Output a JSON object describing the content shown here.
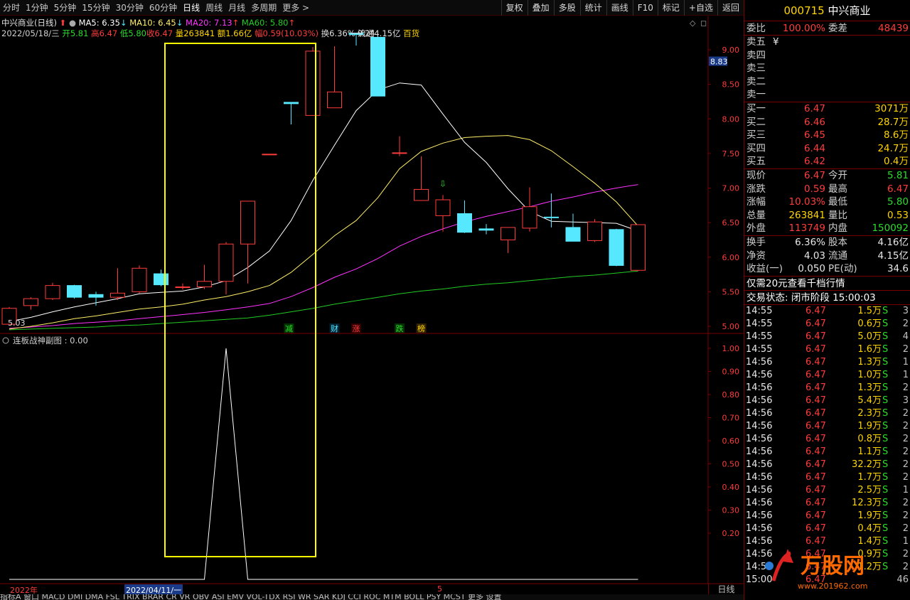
{
  "toolbar": {
    "periods": [
      "分时",
      "1分钟",
      "5分钟",
      "15分钟",
      "30分钟",
      "60分钟",
      "日线",
      "周线",
      "月线",
      "多周期",
      "更多 >"
    ],
    "active_period": "日线",
    "buttons": [
      "复权",
      "叠加",
      "多股",
      "统计",
      "画线",
      "F10",
      "标记",
      "+自选",
      "返回"
    ]
  },
  "chart_header": {
    "title": "中兴商业(日线)",
    "ma5": "MA5: 6.35",
    "ma10": "MA10: 6.45",
    "ma20": "MA20: 7.13",
    "ma60": "MA60: 5.80",
    "date": "2022/05/18/三",
    "open": "开5.81",
    "high": "高6.47",
    "low": "低5.80",
    "close": "收6.47",
    "volume": "量263841",
    "amount": "额1.66亿",
    "change": "幅0.59(10.03%)",
    "turnover": "换6.36%",
    "float_cap": "流通4.15亿",
    "sector": "百货",
    "current_price_tag": "8.83",
    "high_label": "9.24",
    "low_label": "5.03",
    "price_ticks": [
      "9.00",
      "8.50",
      "8.00",
      "7.50",
      "7.00",
      "6.50",
      "6.00",
      "5.50",
      "5.00"
    ],
    "event_markers": [
      "减",
      "财",
      "涨",
      "跌",
      "榜"
    ]
  },
  "indicator": {
    "title": "连板战神副图 : 0.00",
    "ticks": [
      "1.00",
      "0.90",
      "0.80",
      "0.70",
      "0.60",
      "0.50",
      "0.40",
      "0.30",
      "0.20"
    ]
  },
  "time_axis": {
    "year": "2022年",
    "cursor_date": "2022/04/11/一",
    "month": "5",
    "period_label": "日线"
  },
  "bottom_tabs": "指标A 窗口  MACD  DMI  DMA  FSL  TRIX  BRAR  CR  VR  OBV  ASI  EMV  VOL-TDX  RSI  WR  SAR  KDJ  CCI  ROC  MTM  BOLL  PSY  MCST  更多  设置",
  "quote": {
    "code": "000715",
    "name": "中兴商业",
    "weibi_label": "委比",
    "weibi": "100.00%",
    "weicha_label": "委差",
    "weicha": "48439",
    "sell": [
      {
        "label": "卖五",
        "price": "¥",
        "vol": ""
      },
      {
        "label": "卖四",
        "price": "",
        "vol": ""
      },
      {
        "label": "卖三",
        "price": "",
        "vol": ""
      },
      {
        "label": "卖二",
        "price": "",
        "vol": ""
      },
      {
        "label": "卖一",
        "price": "",
        "vol": ""
      }
    ],
    "buy": [
      {
        "label": "买一",
        "price": "6.47",
        "vol": "3071万"
      },
      {
        "label": "买二",
        "price": "6.46",
        "vol": "28.7万"
      },
      {
        "label": "买三",
        "price": "6.45",
        "vol": "8.6万"
      },
      {
        "label": "买四",
        "price": "6.44",
        "vol": "24.7万"
      },
      {
        "label": "买五",
        "price": "6.42",
        "vol": "0.4万"
      }
    ],
    "stats": [
      {
        "l1": "现价",
        "v1": "6.47",
        "c1": "red",
        "l2": "今开",
        "v2": "5.81",
        "c2": "green"
      },
      {
        "l1": "涨跌",
        "v1": "0.59",
        "c1": "red",
        "l2": "最高",
        "v2": "6.47",
        "c2": "red"
      },
      {
        "l1": "涨幅",
        "v1": "10.03%",
        "c1": "red",
        "l2": "最低",
        "v2": "5.80",
        "c2": "green"
      },
      {
        "l1": "总量",
        "v1": "263841",
        "c1": "yellow",
        "l2": "量比",
        "v2": "0.53",
        "c2": "yellow"
      },
      {
        "l1": "外盘",
        "v1": "113749",
        "c1": "red",
        "l2": "内盘",
        "v2": "150092",
        "c2": "green"
      }
    ],
    "fin": [
      {
        "l1": "换手",
        "v1": "6.36%",
        "l2": "股本",
        "v2": "4.16亿"
      },
      {
        "l1": "净资",
        "v1": "4.03",
        "l2": "流通",
        "v2": "4.15亿"
      },
      {
        "l1": "收益(一)",
        "v1": "0.050",
        "l2": "PE(动)",
        "v2": "34.6"
      }
    ],
    "promo": "仅需20元查看千档行情",
    "trade_status": "交易状态: 闭市阶段 15:00:03",
    "trades": [
      {
        "t": "14:55",
        "p": "6.47",
        "v": "1.5万",
        "s": "S",
        "n": "3"
      },
      {
        "t": "14:55",
        "p": "6.47",
        "v": "0.6万",
        "s": "S",
        "n": "2"
      },
      {
        "t": "14:55",
        "p": "6.47",
        "v": "5.0万",
        "s": "S",
        "n": "4"
      },
      {
        "t": "14:55",
        "p": "6.47",
        "v": "1.6万",
        "s": "S",
        "n": "2"
      },
      {
        "t": "14:56",
        "p": "6.47",
        "v": "1.3万",
        "s": "S",
        "n": "1"
      },
      {
        "t": "14:56",
        "p": "6.47",
        "v": "1.0万",
        "s": "S",
        "n": "1"
      },
      {
        "t": "14:56",
        "p": "6.47",
        "v": "1.3万",
        "s": "S",
        "n": "2"
      },
      {
        "t": "14:56",
        "p": "6.47",
        "v": "5.4万",
        "s": "S",
        "n": "3"
      },
      {
        "t": "14:56",
        "p": "6.47",
        "v": "2.3万",
        "s": "S",
        "n": "2"
      },
      {
        "t": "14:56",
        "p": "6.47",
        "v": "1.9万",
        "s": "S",
        "n": "2"
      },
      {
        "t": "14:56",
        "p": "6.47",
        "v": "0.8万",
        "s": "S",
        "n": "2"
      },
      {
        "t": "14:56",
        "p": "6.47",
        "v": "1.1万",
        "s": "S",
        "n": "2"
      },
      {
        "t": "14:56",
        "p": "6.47",
        "v": "32.2万",
        "s": "S",
        "n": "2"
      },
      {
        "t": "14:56",
        "p": "6.47",
        "v": "1.7万",
        "s": "S",
        "n": "2"
      },
      {
        "t": "14:56",
        "p": "6.47",
        "v": "2.5万",
        "s": "S",
        "n": "1"
      },
      {
        "t": "14:56",
        "p": "6.47",
        "v": "12.3万",
        "s": "S",
        "n": "2"
      },
      {
        "t": "14:56",
        "p": "6.47",
        "v": "1.9万",
        "s": "S",
        "n": "2"
      },
      {
        "t": "14:56",
        "p": "6.47",
        "v": "0.4万",
        "s": "S",
        "n": "2"
      },
      {
        "t": "14:56",
        "p": "6.47",
        "v": "1.4万",
        "s": "S",
        "n": "1"
      },
      {
        "t": "14:56",
        "p": "6.47",
        "v": "0.9万",
        "s": "S",
        "n": "2"
      },
      {
        "t": "14:56",
        "p": "6.47",
        "v": "1.2万",
        "s": "S",
        "n": "2"
      },
      {
        "t": "15:00",
        "p": "6.47",
        "v": "",
        "s": "",
        "n": "46"
      }
    ]
  },
  "watermark": {
    "brand": "万股网",
    "url": "www.201962.com"
  },
  "colors": {
    "up": "#ff3c3c",
    "down": "#56e8ff",
    "ma5": "#ffffff",
    "ma10": "#ffee66",
    "ma20": "#ff33ff",
    "ma60": "#22cc22",
    "highlight_box": "#ffff00",
    "grid": "#7a0000"
  },
  "chart_data": {
    "type": "candlestick",
    "price_axis": [
      5.0,
      9.0
    ],
    "candles": [
      {
        "o": 5.03,
        "h": 5.28,
        "l": 5.03,
        "c": 5.26
      },
      {
        "o": 5.3,
        "h": 5.42,
        "l": 5.24,
        "c": 5.4
      },
      {
        "o": 5.4,
        "h": 5.63,
        "l": 5.38,
        "c": 5.59
      },
      {
        "o": 5.59,
        "h": 5.6,
        "l": 5.4,
        "c": 5.42
      },
      {
        "o": 5.46,
        "h": 5.5,
        "l": 5.3,
        "c": 5.42
      },
      {
        "o": 5.42,
        "h": 5.84,
        "l": 5.38,
        "c": 5.48
      },
      {
        "o": 5.5,
        "h": 5.88,
        "l": 5.48,
        "c": 5.84
      },
      {
        "o": 5.76,
        "h": 5.82,
        "l": 5.58,
        "c": 5.6
      },
      {
        "o": 5.56,
        "h": 5.62,
        "l": 5.53,
        "c": 5.57
      },
      {
        "o": 5.57,
        "h": 5.89,
        "l": 5.54,
        "c": 5.65
      },
      {
        "o": 5.65,
        "h": 6.22,
        "l": 5.46,
        "c": 6.19
      },
      {
        "o": 6.19,
        "h": 6.81,
        "l": 5.62,
        "c": 6.81
      },
      {
        "o": 7.49,
        "h": 7.49,
        "l": 7.49,
        "c": 7.49
      },
      {
        "o": 8.24,
        "h": 8.24,
        "l": 7.92,
        "c": 8.22
      },
      {
        "o": 8.05,
        "h": 9.04,
        "l": 8.05,
        "c": 8.98
      },
      {
        "o": 8.16,
        "h": 9.05,
        "l": 8.16,
        "c": 8.39
      },
      {
        "o": 9.24,
        "h": 9.24,
        "l": 9.06,
        "c": 9.22
      },
      {
        "o": 9.18,
        "h": 9.2,
        "l": 8.33,
        "c": 8.33
      },
      {
        "o": 7.51,
        "h": 7.75,
        "l": 7.46,
        "c": 7.51
      },
      {
        "o": 6.82,
        "h": 7.46,
        "l": 6.82,
        "c": 6.98
      },
      {
        "o": 6.6,
        "h": 6.9,
        "l": 6.37,
        "c": 6.83
      },
      {
        "o": 6.63,
        "h": 6.82,
        "l": 6.35,
        "c": 6.36
      },
      {
        "o": 6.41,
        "h": 6.48,
        "l": 6.33,
        "c": 6.39
      },
      {
        "o": 6.25,
        "h": 6.43,
        "l": 6.06,
        "c": 6.43
      },
      {
        "o": 6.42,
        "h": 7.01,
        "l": 6.37,
        "c": 6.73
      },
      {
        "o": 6.58,
        "h": 6.92,
        "l": 6.43,
        "c": 6.57
      },
      {
        "o": 6.43,
        "h": 6.63,
        "l": 6.23,
        "c": 6.23
      },
      {
        "o": 6.24,
        "h": 6.55,
        "l": 6.22,
        "c": 6.51
      },
      {
        "o": 6.4,
        "h": 6.41,
        "l": 5.87,
        "c": 5.88
      },
      {
        "o": 5.81,
        "h": 6.47,
        "l": 5.8,
        "c": 6.47
      }
    ],
    "ma5": [
      5.07,
      5.13,
      5.21,
      5.28,
      5.34,
      5.4,
      5.47,
      5.49,
      5.51,
      5.57,
      5.66,
      5.85,
      6.09,
      6.53,
      7.11,
      7.62,
      8.12,
      8.42,
      8.52,
      8.49,
      8.07,
      7.66,
      7.37,
      6.99,
      6.66,
      6.52,
      6.51,
      6.5,
      6.49,
      6.38
    ],
    "ma10": [
      4.96,
      5.0,
      5.05,
      5.11,
      5.15,
      5.2,
      5.25,
      5.28,
      5.32,
      5.38,
      5.43,
      5.5,
      5.59,
      5.78,
      6.04,
      6.31,
      6.53,
      6.86,
      7.28,
      7.53,
      7.65,
      7.73,
      7.75,
      7.76,
      7.7,
      7.54,
      7.31,
      7.07,
      6.8,
      6.45
    ],
    "ma20": [
      4.97,
      4.99,
      5.01,
      5.04,
      5.06,
      5.08,
      5.11,
      5.14,
      5.17,
      5.2,
      5.24,
      5.28,
      5.33,
      5.43,
      5.56,
      5.71,
      5.83,
      5.98,
      6.16,
      6.3,
      6.41,
      6.51,
      6.59,
      6.66,
      6.73,
      6.81,
      6.87,
      6.94,
      7.0,
      7.05
    ],
    "ma60": [
      4.95,
      4.96,
      4.97,
      4.98,
      4.99,
      5.01,
      5.02,
      5.04,
      5.06,
      5.08,
      5.1,
      5.12,
      5.16,
      5.21,
      5.26,
      5.32,
      5.37,
      5.42,
      5.47,
      5.51,
      5.54,
      5.58,
      5.61,
      5.63,
      5.66,
      5.69,
      5.72,
      5.74,
      5.77,
      5.8
    ],
    "indicator_values": [
      0,
      0,
      0,
      0,
      0,
      0,
      0,
      0,
      0,
      0,
      1,
      0,
      0,
      0,
      0,
      0,
      0,
      0,
      0,
      0,
      0,
      0,
      0,
      0,
      0,
      0,
      0,
      0,
      0,
      0
    ]
  }
}
